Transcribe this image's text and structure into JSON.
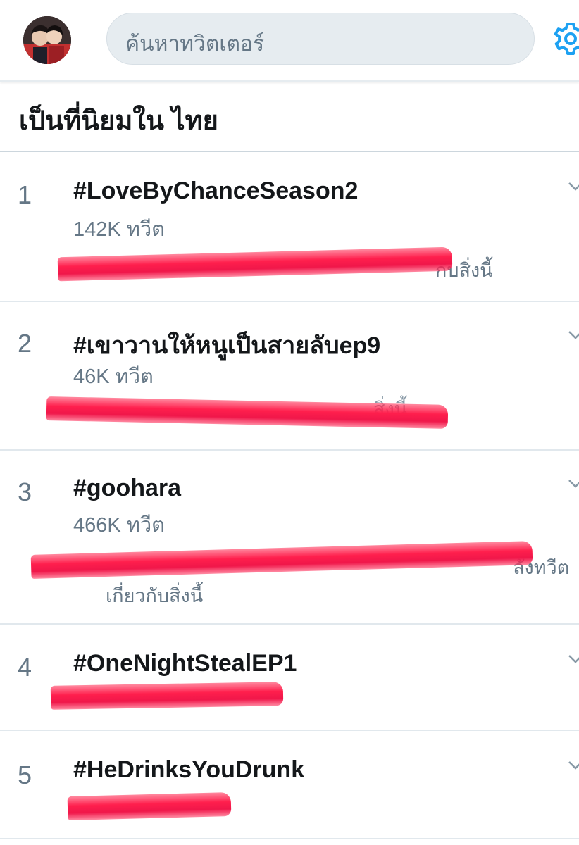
{
  "header": {
    "search_placeholder": "ค้นหาทวิตเตอร์"
  },
  "section": {
    "title": "เป็นที่นิยมใน ไทย"
  },
  "trends": [
    {
      "rank": "1",
      "hashtag": "#LoveByChanceSeason2",
      "count": "142K ทวีต",
      "context_visible": "กับสิ่งนี้"
    },
    {
      "rank": "2",
      "hashtag": "#เขาวานให้หนูเป็นสายลับep9",
      "count": "46K ทวีต",
      "context_visible": "สิ่งนี้"
    },
    {
      "rank": "3",
      "hashtag": "#goohara",
      "count": "466K ทวีต",
      "context_visible_right": "ลังทวีต",
      "context_line2": "เกี่ยวกับสิ่งนี้"
    },
    {
      "rank": "4",
      "hashtag": "#OneNightStealEP1"
    },
    {
      "rank": "5",
      "hashtag": "#HeDrinksYouDrunk"
    }
  ],
  "colors": {
    "accent": "#1da1f2",
    "text_primary": "#14171a",
    "text_secondary": "#657786",
    "search_bg": "#e6ecf0",
    "redaction": "#ff1f4d"
  },
  "icons": {
    "settings": "gear-icon",
    "chevron": "chevron-down-icon"
  }
}
